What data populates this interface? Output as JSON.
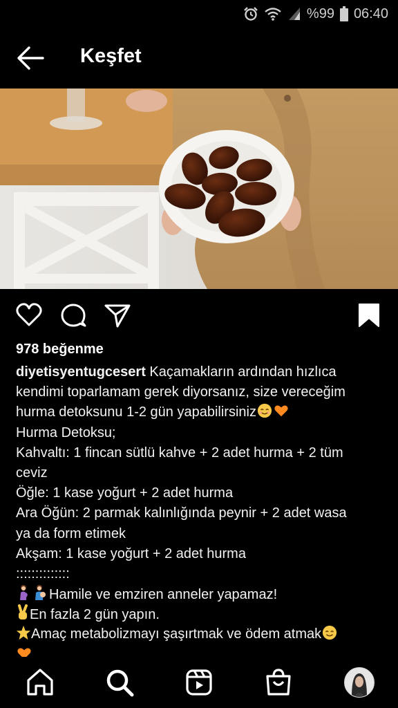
{
  "status_bar": {
    "battery_text": "%99",
    "time": "06:40"
  },
  "header": {
    "title": "Keşfet"
  },
  "post": {
    "likes": "978 beğenme",
    "username": "diyetisyentugcesert",
    "caption_line1": "Kaçamakların ardından hızlıca",
    "caption_line2": "kendimi toparlamam gerek diyorsanız, size vereceğim",
    "caption_line3": "hurma detoksunu 1-2 gün yapabilirsiniz",
    "caption_line4": "Hurma Detoksu;",
    "caption_line5": "Kahvaltı: 1 fincan sütlü kahve + 2 adet hurma + 2 tüm",
    "caption_line6": "ceviz",
    "caption_line7": "Öğle: 1 kase yoğurt + 2 adet hurma",
    "caption_line8": "Ara Öğün: 2 parmak kalınlığında peynir + 2 adet wasa",
    "caption_line9": "ya da form etimek",
    "caption_line10": "Akşam: 1 kase yoğurt + 2 adet hurma",
    "caption_line11": "::::::::::::::",
    "caption_line12": "Hamile ve emziren anneler yapamaz!",
    "caption_line13": "En fazla 2 gün yapın.",
    "caption_line14": "Amaç metabolizmayı şaşırtmak ve ödem atmak"
  },
  "icons": {
    "back": "arrow-left-icon",
    "like": "heart-icon",
    "comment": "comment-icon",
    "share": "send-icon",
    "save": "bookmark-icon",
    "home": "home-icon",
    "search": "search-icon",
    "reels": "reels-icon",
    "shop": "shop-icon"
  },
  "colors": {
    "background": "#000000",
    "text": "#ffffff",
    "heart_emoji": "#ff8a1f",
    "smile_emoji": "#f7c948"
  }
}
